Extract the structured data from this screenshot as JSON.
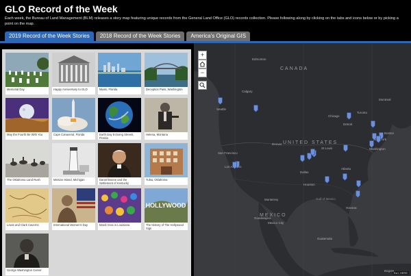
{
  "header": {
    "title": "GLO Record of the Week",
    "intro": "Each week, the Bureau of Land Management (BLM) releases a story map featuring unique records from the General Land Office (GLO) records collection. Please following along by clicking on the tabs and icons below or by picking a point on the map."
  },
  "tabs": [
    {
      "label": "2019 Record of the Week Stories",
      "active": true
    },
    {
      "label": "2018 Record of the Week Stories",
      "active": false
    },
    {
      "label": "America's Original GIS",
      "active": false
    }
  ],
  "stories": [
    {
      "caption": "Memorial Day"
    },
    {
      "caption": "Happy Anniversary to GLO"
    },
    {
      "caption": "Miami, Florida"
    },
    {
      "caption": "Deception Pass, Washington"
    },
    {
      "caption": "May the Fourth Be With You"
    },
    {
      "caption": "Cape Canaveral, Florida"
    },
    {
      "caption": "Earth Day Echoing Streets, Florida"
    },
    {
      "caption": "Helena, Montana"
    },
    {
      "caption": "The Oklahoma Land Rush"
    },
    {
      "caption": "Mission Island, Michigan"
    },
    {
      "caption": "Daniel Boone and the Settlement of Kentucky"
    },
    {
      "caption": "Tulsa, Oklahoma"
    },
    {
      "caption": "Lewis and Clark Caverns"
    },
    {
      "caption": "International Women's Day"
    },
    {
      "caption": "Mardi Gras in Louisiana"
    },
    {
      "caption": "The History of The Hollywood Sign"
    },
    {
      "caption": "George Washington Carver"
    }
  ],
  "map": {
    "zoom_in": "+",
    "zoom_out": "−",
    "home_icon": "home-icon",
    "search_icon": "search-icon",
    "labels": {
      "canada": "CANADA",
      "united_states": "UNITED STATES",
      "mexico": "MEXICO",
      "gulf": "Gulf of Mexico",
      "edmonton": "Edmonton",
      "calgary": "Calgary",
      "seattle": "Seattle",
      "san_francisco": "San Francisco",
      "los_angeles": "Los Angeles",
      "denver": "Denver",
      "dallas": "Dallas",
      "houston": "Houston",
      "chicago": "Chicago",
      "detroit": "Detroit",
      "toronto": "Toronto",
      "montreal": "Montreal",
      "boston": "Boston",
      "new_york": "New York",
      "washington": "Washington",
      "st_louis": "St Louis",
      "atlanta": "Atlanta",
      "havana": "Havana",
      "monterrey": "Monterrey",
      "guadalajara": "Guadalajara",
      "mexico_city": "Mexico City",
      "guatemala": "Guatemala",
      "bogota": "Bogota"
    },
    "attribution": "Esri, HERE"
  },
  "colors": {
    "tab_active": "#2b67b6",
    "tab_inactive": "#6e6e6e",
    "panel_bg": "#d8d8d8",
    "map_bg": "#3a3b3f",
    "land": "#2c2d30",
    "pin": "#6f8fd6"
  }
}
